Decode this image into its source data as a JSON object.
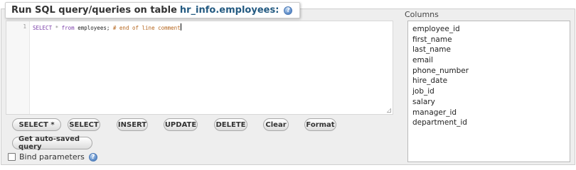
{
  "legend": {
    "prefix": "Run SQL query/queries on table",
    "table": "hr_info.employees:"
  },
  "editor": {
    "line_number": "1",
    "tokens": {
      "kw1": "SELECT",
      "star": "*",
      "kw2": "from",
      "table": "employees;",
      "comment": "# end of line comment"
    }
  },
  "buttons": {
    "select_star": "SELECT *",
    "select": "SELECT",
    "insert": "INSERT",
    "update": "UPDATE",
    "delete": "DELETE",
    "clear": "Clear",
    "format": "Format",
    "get_autosaved": "Get auto-saved query"
  },
  "bind_parameters": {
    "label": "Bind parameters",
    "checked": false
  },
  "columns": {
    "title": "Columns",
    "items": [
      "employee_id",
      "first_name",
      "last_name",
      "email",
      "phone_number",
      "hire_date",
      "job_id",
      "salary",
      "manager_id",
      "department_id"
    ]
  },
  "icons": {
    "help": "help-icon"
  }
}
